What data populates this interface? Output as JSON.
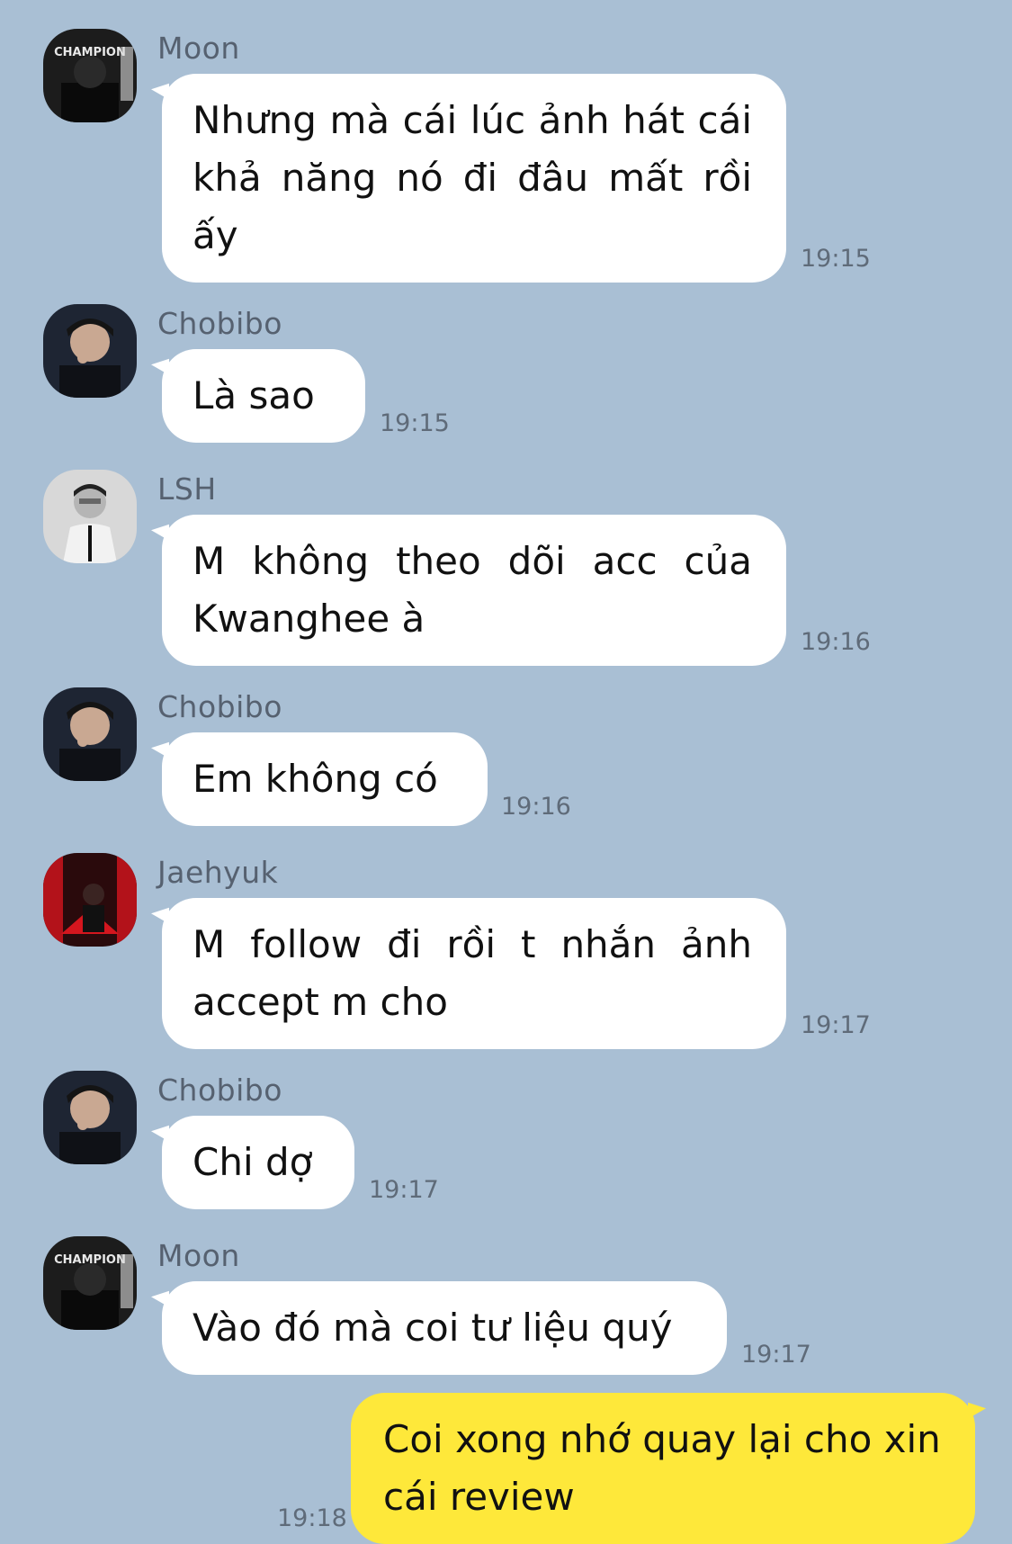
{
  "messages": [
    {
      "sender": "Moon",
      "text": "Nhưng mà cái lúc ảnh hát cái khả năng nó đi đâu mất rồi ấy",
      "time": "19:15"
    },
    {
      "sender": "Chobibo",
      "text": "Là sao",
      "time": "19:15"
    },
    {
      "sender": "LSH",
      "text": "M không theo dõi acc của Kwanghee à",
      "time": "19:16"
    },
    {
      "sender": "Chobibo",
      "text": "Em không có",
      "time": "19:16"
    },
    {
      "sender": "Jaehyuk",
      "text": "M follow đi rồi t nhắn ảnh accept m cho",
      "time": "19:17"
    },
    {
      "sender": "Chobibo",
      "text": "Chi dợ",
      "time": "19:17"
    },
    {
      "sender": "Moon",
      "text": "Vào đó mà coi tư liệu quý",
      "time": "19:17"
    },
    {
      "sender": "",
      "text": "Coi xong nhớ quay lại cho xin cái review",
      "time": "19:18"
    }
  ],
  "colors": {
    "background": "#a9bfd4",
    "incoming_bubble": "#ffffff",
    "outgoing_bubble": "#fee83a"
  }
}
